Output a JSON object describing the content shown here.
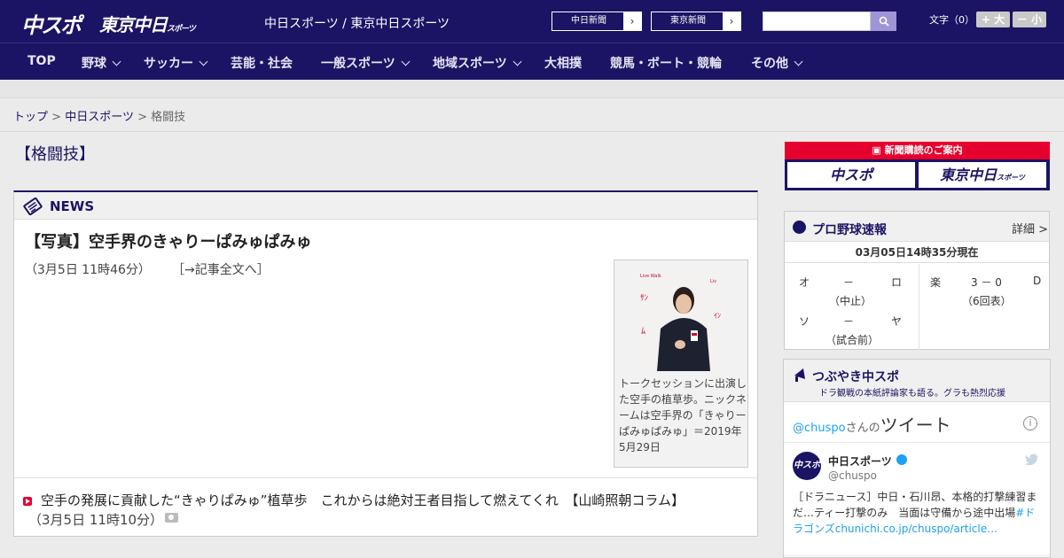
{
  "header": {
    "logo_chuspo": "中スポ",
    "logo_tokyo": "東京中日",
    "logo_tokyo_suffix": "スポーツ",
    "site_title": "中日スポーツ / 東京中日スポーツ",
    "links": [
      {
        "label": "中日新聞",
        "icon": "chevron-right-icon"
      },
      {
        "label": "東京新聞",
        "icon": "chevron-right-icon"
      }
    ],
    "search_value": "",
    "search_icon": "search-icon",
    "fontsize_label": "文字（0）",
    "fontsize_up": "+ 大",
    "fontsize_down": "－ 小"
  },
  "nav": {
    "items": [
      {
        "label": "TOP",
        "has_dropdown": false
      },
      {
        "label": "野球",
        "has_dropdown": true
      },
      {
        "label": "サッカー",
        "has_dropdown": true
      },
      {
        "label": "芸能・社会",
        "has_dropdown": false
      },
      {
        "label": "一般スポーツ",
        "has_dropdown": true
      },
      {
        "label": "地域スポーツ",
        "has_dropdown": true
      },
      {
        "label": "大相撲",
        "has_dropdown": false
      },
      {
        "label": "競馬・ボート・競輪",
        "has_dropdown": false
      },
      {
        "label": "その他",
        "has_dropdown": true
      }
    ]
  },
  "breadcrumb": {
    "items": [
      "トップ",
      "中日スポーツ",
      "格闘技"
    ],
    "separator": ">"
  },
  "page_title": "【格闘技】",
  "news": {
    "heading": "NEWS",
    "main_article": {
      "title": "【写真】空手界のきゃりーぱみゅぱみゅ",
      "date": "（3月5日 11時46分）",
      "more_link": "［→記事全文へ］",
      "photo_caption": "トークセッションに出演した空手の植草歩。ニックネームは空手界の「きゃりーぱみゅぱみゅ」＝2019年5月29日"
    },
    "sub_article": {
      "title": "空手の発展に貢献した“きゃりぱみゅ”植草歩　これからは絶対王者目指して燃えてくれ　【山崎照朝コラム】",
      "date": "（3月5日 11時10分）",
      "icon": "camera-icon"
    }
  },
  "sidebar": {
    "promo": {
      "heading": "新聞購読のご案内",
      "btn_chuspo": "中スポ",
      "btn_tokyo": "東京中日",
      "btn_tokyo_suffix": "スポーツ"
    },
    "scores": {
      "heading": "プロ野球速報",
      "more": "詳細 >",
      "timestamp": "03月05日14時35分現在",
      "games": [
        {
          "home": "オ",
          "score": "－",
          "away": "ロ",
          "status": "（中止）"
        },
        {
          "home": "ソ",
          "score": "－",
          "away": "ヤ",
          "status": "（試合前）"
        },
        {
          "home": "楽",
          "score": "3 － 0",
          "away": "D",
          "status": "（6回表）"
        }
      ]
    },
    "tweets": {
      "heading": "つぶやき中スポ",
      "subheading": "ドラ観戦の本紙評論家も語る。グラも熱烈応援",
      "handle_link": "@chuspo",
      "handle_suffix": "さんの",
      "title_big": "ツイート",
      "info": "i",
      "avatar_text": "中スポ",
      "tweet_name": "中日スポーツ",
      "tweet_user": "@chuspo",
      "tweet_text": "［ドラニュース］中日・石川昂、本格的打撃練習まだ…ティー打撃のみ　当面は守備から途中出場",
      "tweet_hashtag": "#ドラゴンズ",
      "tweet_link": "chunichi.co.jp/chuspo/article…"
    }
  },
  "colors": {
    "brand_navy": "#1b1464",
    "accent_red": "#e6002d",
    "link_blue": "#1da1f2"
  }
}
